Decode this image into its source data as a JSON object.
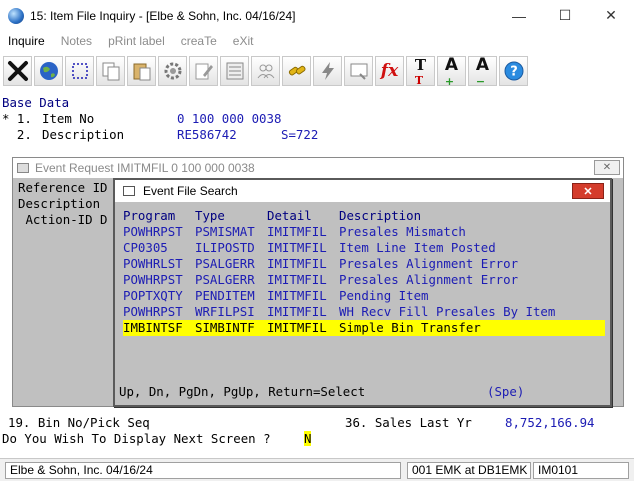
{
  "window": {
    "title": "15: Item File Inquiry - [Elbe & Sohn, Inc. 04/16/24]",
    "minimize_glyph": "—",
    "maximize_glyph": "☐",
    "close_glyph": "✕"
  },
  "menu": [
    {
      "label": "Inquire",
      "enabled": true
    },
    {
      "label": "Notes",
      "enabled": false
    },
    {
      "label": "pRint label",
      "enabled": false
    },
    {
      "label": "creaTe",
      "enabled": false
    },
    {
      "label": "eXit",
      "enabled": false
    }
  ],
  "toolbar": [
    {
      "icon": "close-x-icon"
    },
    {
      "icon": "globe-icon"
    },
    {
      "icon": "select-rect-icon"
    },
    {
      "icon": "copy-icon"
    },
    {
      "icon": "paste-icon"
    },
    {
      "icon": "gear-icon"
    },
    {
      "icon": "edit-icon"
    },
    {
      "icon": "list-icon"
    },
    {
      "icon": "users-icon"
    },
    {
      "icon": "link-icon"
    },
    {
      "icon": "lightning-icon"
    },
    {
      "icon": "screen-icon"
    },
    {
      "icon": "function-icon"
    },
    {
      "icon": "text-size-icon"
    },
    {
      "icon": "font-increase-icon"
    },
    {
      "icon": "font-decrease-icon"
    },
    {
      "icon": "help-icon"
    }
  ],
  "terminal": {
    "section_title": "Base Data",
    "field1": {
      "marker": "* 1.",
      "label": "Item No",
      "value": "0 100 000 0038"
    },
    "field2": {
      "marker": "  2.",
      "label": "Description",
      "value": "RE586742",
      "extra": "S=722"
    },
    "field19": {
      "label": "19. Bin No/Pick Seq"
    },
    "field36": {
      "label": "36. Sales Last Yr",
      "value": "8,752,166.94"
    },
    "prompt": "Do You Wish To Display Next Screen ?",
    "prompt_answer": "N"
  },
  "event_request": {
    "title": "Event Request IMITMFIL 0 100 000 0038",
    "lines": [
      "Reference ID",
      "Description",
      " Action-ID D"
    ]
  },
  "event_file_search": {
    "title": "Event File Search",
    "columns": [
      "Program",
      "Type",
      "Detail",
      "Description"
    ],
    "rows": [
      {
        "program": "POWHRPST",
        "type": "PSMISMAT",
        "detail": "IMITMFIL",
        "description": "Presales Mismatch",
        "selected": false
      },
      {
        "program": "CP0305",
        "type": "ILIPOSTD",
        "detail": "IMITMFIL",
        "description": "Item Line Item Posted",
        "selected": false
      },
      {
        "program": "POWHRLST",
        "type": "PSALGERR",
        "detail": "IMITMFIL",
        "description": "Presales Alignment Error",
        "selected": false
      },
      {
        "program": "POWHRPST",
        "type": "PSALGERR",
        "detail": "IMITMFIL",
        "description": "Presales Alignment Error",
        "selected": false
      },
      {
        "program": "POPTXQTY",
        "type": "PENDITEM",
        "detail": "IMITMFIL",
        "description": "Pending Item",
        "selected": false
      },
      {
        "program": "POWHRPST",
        "type": "WRFILPSI",
        "detail": "IMITMFIL",
        "description": "WH Recv Fill Presales By Item",
        "selected": false
      },
      {
        "program": "IMBINTSF",
        "type": "SIMBINTF",
        "detail": "IMITMFIL",
        "description": "Simple Bin Transfer",
        "selected": true
      }
    ],
    "footer_hint": "Up, Dn, PgDn, PgUp, Return=Select",
    "footer_mode": "(Spe)"
  },
  "status_bar": {
    "company": "Elbe & Sohn, Inc. 04/16/24",
    "session": "001 EMK at DB1EMK",
    "program": "IM0101"
  },
  "colors": {
    "terminal_text": "#000000",
    "terminal_value": "#1c1cb4",
    "selection": "#ffff00",
    "dialog_bg": "#c0c0c0",
    "close_red": "#d43c2c"
  }
}
